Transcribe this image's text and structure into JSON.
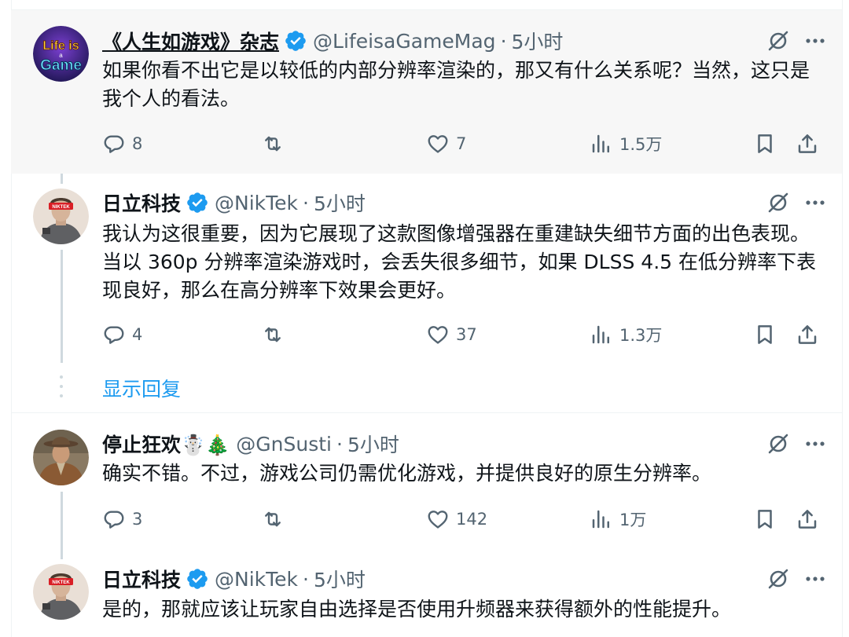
{
  "colors": {
    "accent": "#1d9bf0",
    "muted": "#536471",
    "text": "#0f1419",
    "verified": "#1d9bf0",
    "highlight_bg": "#f7f7f7"
  },
  "icons": [
    "reply-icon",
    "retweet-icon",
    "like-icon",
    "views-icon",
    "bookmark-icon",
    "share-icon",
    "grok-icon",
    "more-icon",
    "verified-badge-icon"
  ],
  "tweets": [
    {
      "display_name": "《人生如游戏》杂志",
      "handle": "@LifeisaGameMag",
      "dot": "·",
      "time": "5小时",
      "text": "如果你看不出它是以较低的内部分辨率渲染的，那又有什么关系呢？当然，这只是我个人的看法。",
      "avatar_label": "Life is a Game",
      "replies": "8",
      "retweets": "",
      "likes": "7",
      "views": "1.5万"
    },
    {
      "display_name": "日立科技",
      "handle": "@NikTek",
      "dot": "·",
      "time": "5小时",
      "text": "我认为这很重要，因为它展现了这款图像增强器在重建缺失细节方面的出色表现。当以 360p 分辨率渲染游戏时，会丢失很多细节，如果 DLSS 4.5 在低分辨率下表现良好，那么在高分辨率下效果会更好。",
      "avatar_label": "NIKTEK",
      "replies": "4",
      "retweets": "",
      "likes": "37",
      "views": "1.3万"
    },
    {
      "display_name": "停止狂欢☃️🎄",
      "handle": "@GnSusti",
      "dot": "·",
      "time": "5小时",
      "text": "确实不错。不过，游戏公司仍需优化游戏，并提供良好的原生分辨率。",
      "replies": "3",
      "retweets": "",
      "likes": "142",
      "views": "1万"
    },
    {
      "display_name": "日立科技",
      "handle": "@NikTek",
      "dot": "·",
      "time": "5小时",
      "text": "是的，那就应该让玩家自由选择是否使用升频器来获得额外的性能提升。",
      "avatar_label": "NIKTEK"
    }
  ],
  "show_replies": "显示回复"
}
